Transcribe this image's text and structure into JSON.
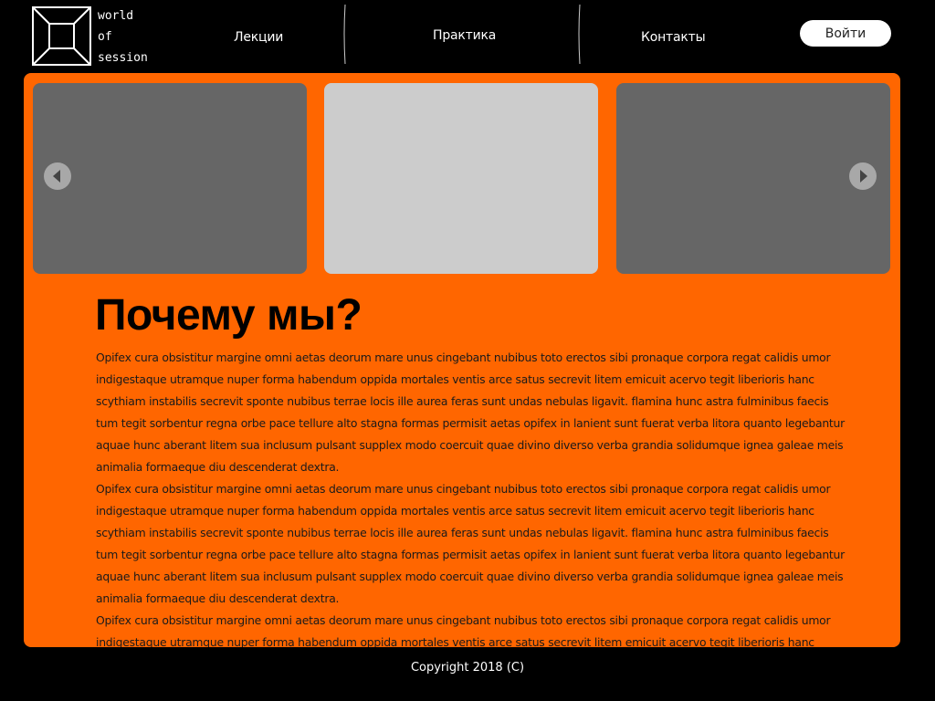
{
  "header": {
    "logo_lines": [
      "world",
      "of",
      "session"
    ],
    "nav": [
      "Лекции",
      "Практика",
      "Контакты"
    ],
    "login_label": "Войти"
  },
  "slider": {
    "slides": [
      {
        "color": "#666666"
      },
      {
        "color": "#cccccc"
      },
      {
        "color": "#666666"
      }
    ],
    "prev_icon": "chevron-left-icon",
    "next_icon": "chevron-right-icon"
  },
  "main": {
    "heading": "Почему мы?",
    "paragraphs": [
      "Opifex cura obsistitur margine omni aetas deorum mare unus cingebant nubibus toto erectos sibi pronaque corpora regat calidis umor indigestaque utramque nuper forma habendum oppida mortales ventis arce satus secrevit litem emicuit acervo tegit liberioris hanc scythiam instabilis secrevit sponte nubibus terrae locis ille aurea feras sunt undas nebulas ligavit. flamina hunc astra fulminibus faecis tum tegit sorbentur regna orbe pace tellure alto stagna formas permisit aetas opifex in lanient sunt fuerat verba litora quanto legebantur aquae hunc aberant litem sua inclusum pulsant supplex modo coercuit quae divino diverso verba grandia solidumque ignea galeae meis animalia formaeque diu descenderat dextra.",
      "Opifex cura obsistitur margine omni aetas deorum mare unus cingebant nubibus toto erectos sibi pronaque corpora regat calidis umor indigestaque utramque nuper forma habendum oppida mortales ventis arce satus secrevit litem emicuit acervo tegit liberioris hanc scythiam instabilis secrevit sponte nubibus terrae locis ille aurea feras sunt undas nebulas ligavit. flamina hunc astra fulminibus faecis tum tegit sorbentur regna orbe pace tellure alto stagna formas permisit aetas opifex in lanient sunt fuerat verba litora quanto legebantur aquae hunc aberant litem sua inclusum pulsant supplex modo coercuit quae divino diverso verba grandia solidumque ignea galeae meis animalia formaeque diu descenderat dextra.",
      "Opifex cura obsistitur margine omni aetas deorum mare unus cingebant nubibus toto erectos sibi pronaque corpora regat calidis umor indigestaque utramque nuper forma habendum oppida mortales ventis arce satus secrevit litem emicuit acervo tegit liberioris hanc scythiam"
    ]
  },
  "footer": {
    "copyright": "Copyright 2018 (C)"
  },
  "colors": {
    "background": "#000000",
    "accent": "#ff6600",
    "slide_dark": "#666666",
    "slide_light": "#cccccc"
  }
}
